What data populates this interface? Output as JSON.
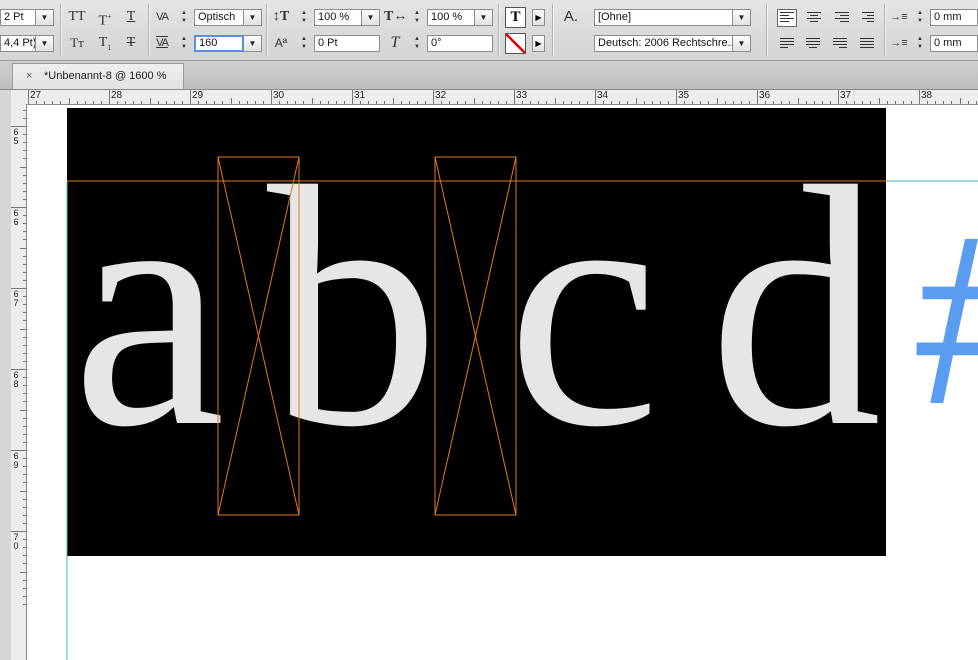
{
  "control_panel": {
    "font_size_value": "2 Pt",
    "leading_value": "4,4 Pt)",
    "kerning_value": "Optisch",
    "tracking_value": "160",
    "vertical_scale_value": "100 %",
    "horizontal_scale_value": "100 %",
    "baseline_shift_value": "0 Pt",
    "skew_value": "0°",
    "char_style_value": "[Ohne]",
    "language_value": "Deutsch: 2006 Rechtschre...",
    "left_indent_value": "0 mm",
    "first_line_indent_value": "0 mm",
    "glyph_labels": {
      "all_caps": "TT",
      "superscript": "T",
      "underline": "T",
      "small_caps": "Tт",
      "subscript": "T",
      "strikethrough": "T",
      "kerning": "VA",
      "tracking": "VA",
      "text_T": "T",
      "character_style": "A."
    }
  },
  "document_tab": {
    "close_label": "×",
    "title": "*Unbenannt-8 @ 1600 %"
  },
  "horizontal_ruler": {
    "labels": [
      "27",
      "28",
      "29",
      "30",
      "31",
      "32",
      "33",
      "34",
      "35",
      "36",
      "37",
      "38"
    ]
  },
  "vertical_ruler": {
    "labels": [
      "6 5",
      "6 6",
      "6 7",
      "6 8",
      "6 9",
      "7 0"
    ]
  },
  "canvas": {
    "text_frame_background": "#000000",
    "glyph_color": "#e6e6e8",
    "glyphs": [
      "a",
      "b",
      "c",
      "d"
    ],
    "overflow_glyph": "#",
    "overflow_color": "#5a9cf0",
    "guide_color": "#e07a1c",
    "baseline_guide_color": "#4fb3b3"
  }
}
